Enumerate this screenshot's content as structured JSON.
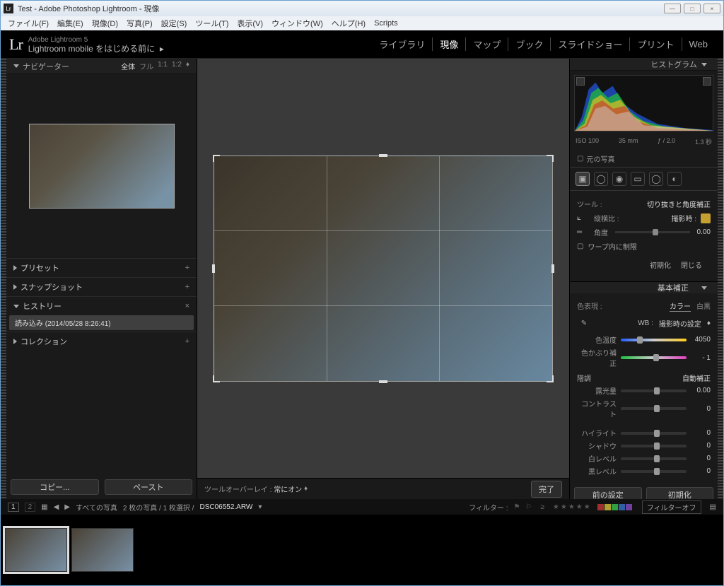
{
  "window": {
    "title": "Test - Adobe Photoshop Lightroom - 現像"
  },
  "menubar": [
    "ファイル(F)",
    "編集(E)",
    "現像(D)",
    "写真(P)",
    "設定(S)",
    "ツール(T)",
    "表示(V)",
    "ウィンドウ(W)",
    "ヘルプ(H)",
    "Scripts"
  ],
  "identity": {
    "version": "Adobe Lightroom 5",
    "mobile": "Lightroom mobile をはじめる前に",
    "arrow": "▸"
  },
  "modules": {
    "items": [
      "ライブラリ",
      "現像",
      "マップ",
      "ブック",
      "スライドショー",
      "プリント",
      "Web"
    ],
    "active": 1
  },
  "left": {
    "navigator": {
      "title": "ナビゲーター",
      "zoom": [
        "全体",
        "フル",
        "1:1",
        "1:2"
      ]
    },
    "presets": "プリセット",
    "snapshots": "スナップショット",
    "history": "ヒストリー",
    "history_item": "読み込み (2014/05/28 8:26:41)",
    "collections": "コレクション",
    "copy": "コピー...",
    "paste": "ペースト"
  },
  "center": {
    "overlay_label": "ツールオーバーレイ :",
    "overlay_value": "常にオン",
    "done": "完了"
  },
  "right": {
    "histogram": "ヒストグラム",
    "exif": {
      "iso": "ISO 100",
      "focal": "35 mm",
      "aperture": "ƒ / 2.0",
      "shutter": "1.3 秒"
    },
    "original": "元の写真",
    "tool": {
      "label": "ツール :",
      "title": "切り抜きと角度補正"
    },
    "aspect": {
      "label": "縦横比 :",
      "value": "撮影時 :"
    },
    "angle": {
      "label": "角度",
      "value": "0.00"
    },
    "constrain": "ワープ内に制限",
    "reset": "初期化",
    "close": "閉じる",
    "basic": "基本補正",
    "treatment_label": "色表現 :",
    "treatment": {
      "color": "カラー",
      "bw": "白黒"
    },
    "wb_label": "WB :",
    "wb_value": "撮影時の設定",
    "temp": {
      "label": "色温度",
      "value": "4050"
    },
    "tint": {
      "label": "色かぶり補正",
      "value": "- 1"
    },
    "tone": "階調",
    "auto": "自動補正",
    "exposure": {
      "label": "露光量",
      "value": "0.00"
    },
    "contrast": {
      "label": "コントラスト",
      "value": "0"
    },
    "highlights": {
      "label": "ハイライト",
      "value": "0"
    },
    "shadows": {
      "label": "シャドウ",
      "value": "0"
    },
    "whites": {
      "label": "白レベル",
      "value": "0"
    },
    "blacks": {
      "label": "黒レベル",
      "value": "0"
    },
    "prev_settings": "前の設定",
    "reset_all": "初期化"
  },
  "filmstrip": {
    "info": "すべての写真",
    "count": "2 枚の写真 / 1 枚選択 /",
    "filename": "DSC06552.ARW",
    "filter_label": "フィルター :",
    "filter_off": "フィルターオフ"
  }
}
